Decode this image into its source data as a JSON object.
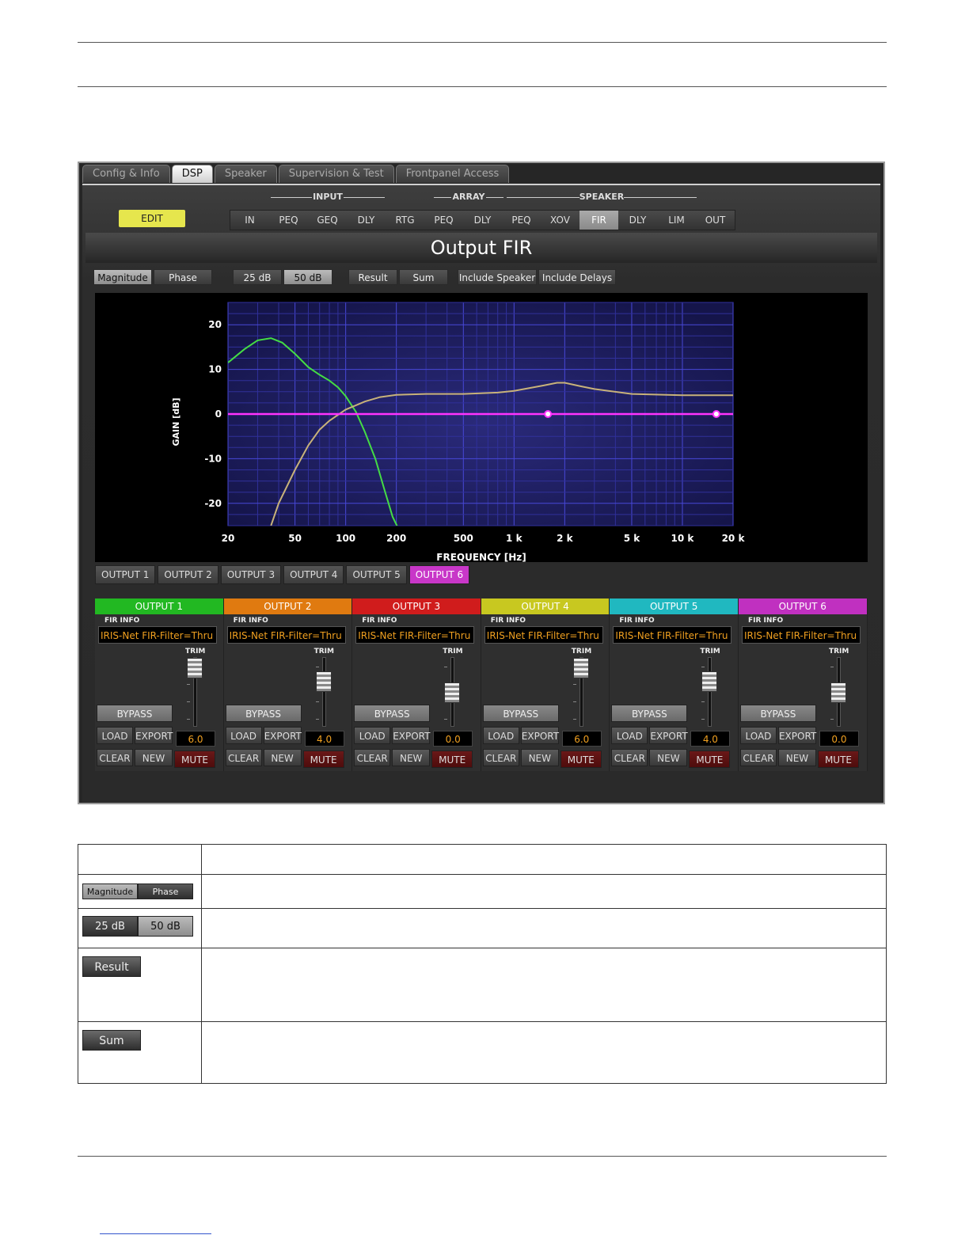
{
  "window_tabs": [
    {
      "label": "Config & Info",
      "active": false
    },
    {
      "label": "DSP",
      "active": true
    },
    {
      "label": "Speaker",
      "active": false
    },
    {
      "label": "Supervision & Test",
      "active": false
    },
    {
      "label": "Frontpanel Access",
      "active": false
    }
  ],
  "groups": {
    "input": "INPUT",
    "array": "ARRAY",
    "speaker": "SPEAKER"
  },
  "edit_label": "EDIT",
  "dsp_nav": [
    "IN",
    "PEQ",
    "GEQ",
    "DLY",
    "RTG",
    "PEQ",
    "DLY",
    "PEQ",
    "XOV",
    "FIR",
    "DLY",
    "LIM",
    "OUT"
  ],
  "dsp_nav_active": "FIR",
  "title": "Output FIR",
  "toolbar": {
    "magnitude": "Magnitude",
    "phase": "Phase",
    "db25": "25 dB",
    "db50": "50 dB",
    "result": "Result",
    "sum": "Sum",
    "include_speaker": "Include Speaker",
    "include_delays": "Include Delays"
  },
  "chart_data": {
    "type": "line",
    "xlabel": "FREQUENCY [Hz]",
    "ylabel": "GAIN [dB]",
    "x_scale": "log",
    "xlim": [
      20,
      20000
    ],
    "ylim": [
      -25,
      25
    ],
    "x_ticks": [
      {
        "v": 20,
        "label": "20"
      },
      {
        "v": 50,
        "label": "50"
      },
      {
        "v": 100,
        "label": "100"
      },
      {
        "v": 200,
        "label": "200"
      },
      {
        "v": 500,
        "label": "500"
      },
      {
        "v": 1000,
        "label": "1 k"
      },
      {
        "v": 2000,
        "label": "2 k"
      },
      {
        "v": 5000,
        "label": "5 k"
      },
      {
        "v": 10000,
        "label": "10 k"
      },
      {
        "v": 20000,
        "label": "20 k"
      }
    ],
    "y_ticks": [
      20,
      10,
      0,
      -10,
      -20
    ],
    "grid": true,
    "series": [
      {
        "color": "#44dd44",
        "x": [
          20,
          25,
          30,
          36,
          42,
          50,
          60,
          70,
          80,
          90,
          100,
          115,
          130,
          150,
          170,
          190,
          220
        ],
        "y": [
          11.5,
          14.5,
          16.5,
          17,
          16,
          13.5,
          10.5,
          8.8,
          7.5,
          6,
          4,
          0.5,
          -4,
          -10,
          -17,
          -23,
          -28
        ]
      },
      {
        "color": "#c8b27a",
        "x": [
          36,
          40,
          50,
          60,
          70,
          80,
          100,
          130,
          160,
          200,
          300,
          500,
          800,
          1000,
          1500,
          1800,
          2000,
          2500,
          3000,
          5000,
          10000,
          20000
        ],
        "y": [
          -25,
          -20,
          -12.5,
          -7,
          -3.5,
          -1.5,
          1,
          2.8,
          3.8,
          4.3,
          4.5,
          4.5,
          4.8,
          5.2,
          6.4,
          7,
          7,
          6.2,
          5.6,
          4.5,
          4.2,
          4.2
        ]
      },
      {
        "color": "#ff33ff",
        "x": [
          20,
          20000
        ],
        "y": [
          0,
          0
        ],
        "markers": [
          {
            "x": 1590,
            "y": 0
          },
          {
            "x": 15900,
            "y": 0
          }
        ]
      }
    ]
  },
  "output_tabs": [
    {
      "label": "OUTPUT 1",
      "active": false
    },
    {
      "label": "OUTPUT 2",
      "active": false
    },
    {
      "label": "OUTPUT 3",
      "active": false
    },
    {
      "label": "OUTPUT 4",
      "active": false
    },
    {
      "label": "OUTPUT 5",
      "active": false
    },
    {
      "label": "OUTPUT 6",
      "active": true
    }
  ],
  "strip_labels": {
    "fir_info": "FIR INFO",
    "trim": "TRIM",
    "bypass": "BYPASS",
    "load": "LOAD",
    "export": "EXPORT",
    "clear": "CLEAR",
    "new": "NEW",
    "mute": "MUTE"
  },
  "outputs": [
    {
      "name": "OUTPUT 1",
      "color": "#22b822",
      "fir": "IRIS-Net FIR-Filter=Thru",
      "trim": "6.0",
      "level": 0.0
    },
    {
      "name": "OUTPUT 2",
      "color": "#e07a10",
      "fir": "IRIS-Net FIR-Filter=Thru",
      "trim": "4.0",
      "level": 0.33
    },
    {
      "name": "OUTPUT 3",
      "color": "#d01c1c",
      "fir": "IRIS-Net FIR-Filter=Thru",
      "trim": "0.0",
      "level": 0.6
    },
    {
      "name": "OUTPUT 4",
      "color": "#c8c820",
      "fir": "IRIS-Net FIR-Filter=Thru",
      "trim": "6.0",
      "level": 0.0
    },
    {
      "name": "OUTPUT 5",
      "color": "#20b8c0",
      "fir": "IRIS-Net FIR-Filter=Thru",
      "trim": "4.0",
      "level": 0.33
    },
    {
      "name": "OUTPUT 6",
      "color": "#c030c0",
      "fir": "IRIS-Net FIR-Filter=Thru",
      "trim": "0.0",
      "level": 0.6
    }
  ],
  "desc_table": {
    "magnitude": "Magnitude",
    "phase": "Phase",
    "db25": "25 dB",
    "db50": "50 dB",
    "result": "Result",
    "sum": "Sum"
  }
}
